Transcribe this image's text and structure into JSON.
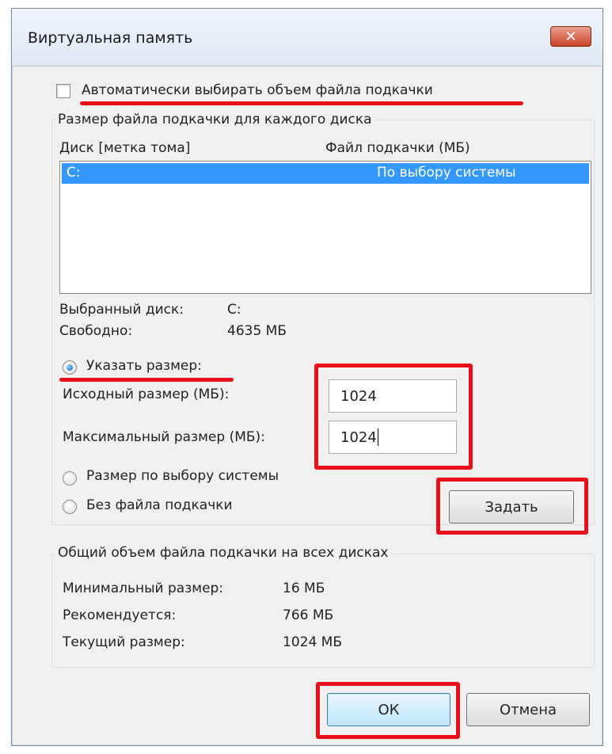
{
  "window": {
    "title": "Виртуальная память",
    "close_glyph": "✕"
  },
  "auto_checkbox": {
    "label": "Автоматически выбирать объем файла подкачки",
    "checked": false
  },
  "per_disk": {
    "legend": "Размер файла подкачки для каждого диска",
    "col_disk": "Диск [метка тома]",
    "col_pagefile": "Файл подкачки (МБ)",
    "rows": [
      {
        "disk": "C:",
        "pagefile": "По выбору системы",
        "selected": true
      }
    ],
    "selected_disk_label": "Выбранный диск:",
    "selected_disk_value": "C:",
    "free_label": "Свободно:",
    "free_value": "4635 МБ"
  },
  "size_options": {
    "custom_label": "Указать размер:",
    "initial_label": "Исходный размер (МБ):",
    "initial_value": "1024",
    "max_label": "Максимальный размер (МБ):",
    "max_value": "1024",
    "system_label": "Размер по выбору системы",
    "none_label": "Без файла подкачки",
    "set_button": "Задать",
    "selected": "custom"
  },
  "totals": {
    "legend": "Общий объем файла подкачки на всех дисках",
    "min_label": "Минимальный размер:",
    "min_value": "16 МБ",
    "rec_label": "Рекомендуется:",
    "rec_value": "766 МБ",
    "cur_label": "Текущий размер:",
    "cur_value": "1024 МБ"
  },
  "buttons": {
    "ok": "ОК",
    "cancel": "Отмена"
  },
  "highlight_color": "#e8101a"
}
